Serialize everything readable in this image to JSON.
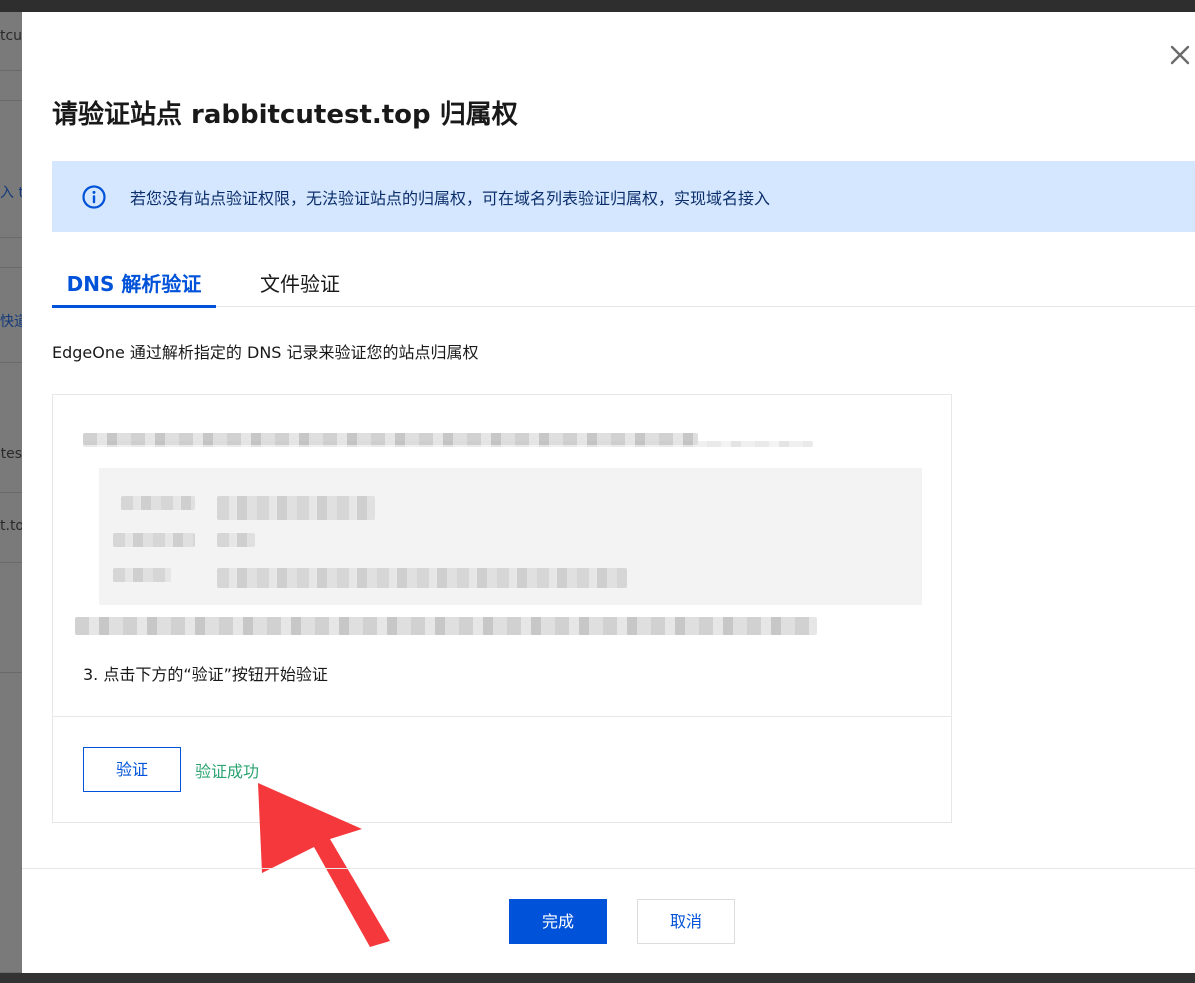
{
  "backdrop": {
    "fragments": [
      "tcu",
      "入 ti",
      "快道",
      "tes",
      "t.to"
    ]
  },
  "dialog": {
    "title": "请验证站点 rabbitcutest.top 归属权",
    "close_icon": "close-icon",
    "alert": {
      "icon": "info-circle-icon",
      "text": "若您没有站点验证权限，无法验证站点的归属权，可在域名列表验证归属权，实现域名接入"
    },
    "tabs": [
      {
        "label": "DNS 解析验证",
        "active": true
      },
      {
        "label": "文件验证",
        "active": false
      }
    ],
    "description": "EdgeOne 通过解析指定的 DNS 记录来验证您的站点归属权",
    "steps": {
      "step3": "3. 点击下方的“验证”按钮开始验证"
    },
    "verify_button": "验证",
    "verify_status": "验证成功",
    "footer": {
      "confirm": "完成",
      "cancel": "取消"
    }
  },
  "colors": {
    "brand": "#0052d9",
    "alert_bg": "#d5e7ff",
    "success": "#2ba471",
    "arrow": "#f5383b"
  }
}
